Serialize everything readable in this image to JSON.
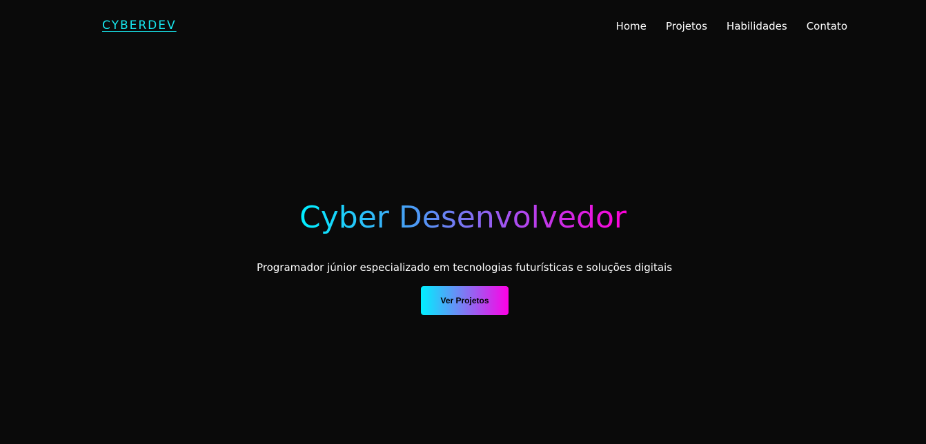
{
  "nav": {
    "logo": "CYBERDEV",
    "links": [
      "Home",
      "Projetos",
      "Habilidades",
      "Contato"
    ]
  },
  "hero": {
    "title": "Cyber Desenvolvedor",
    "subtitle": "Programador júnior especializado em tecnologias futurísticas e soluções digitais",
    "cta_label": "Ver Projetos"
  },
  "colors": {
    "background": "#0a0a0a",
    "accent_cyan": "#00f0ff",
    "accent_magenta": "#ff00d8",
    "text": "#ffffff"
  }
}
